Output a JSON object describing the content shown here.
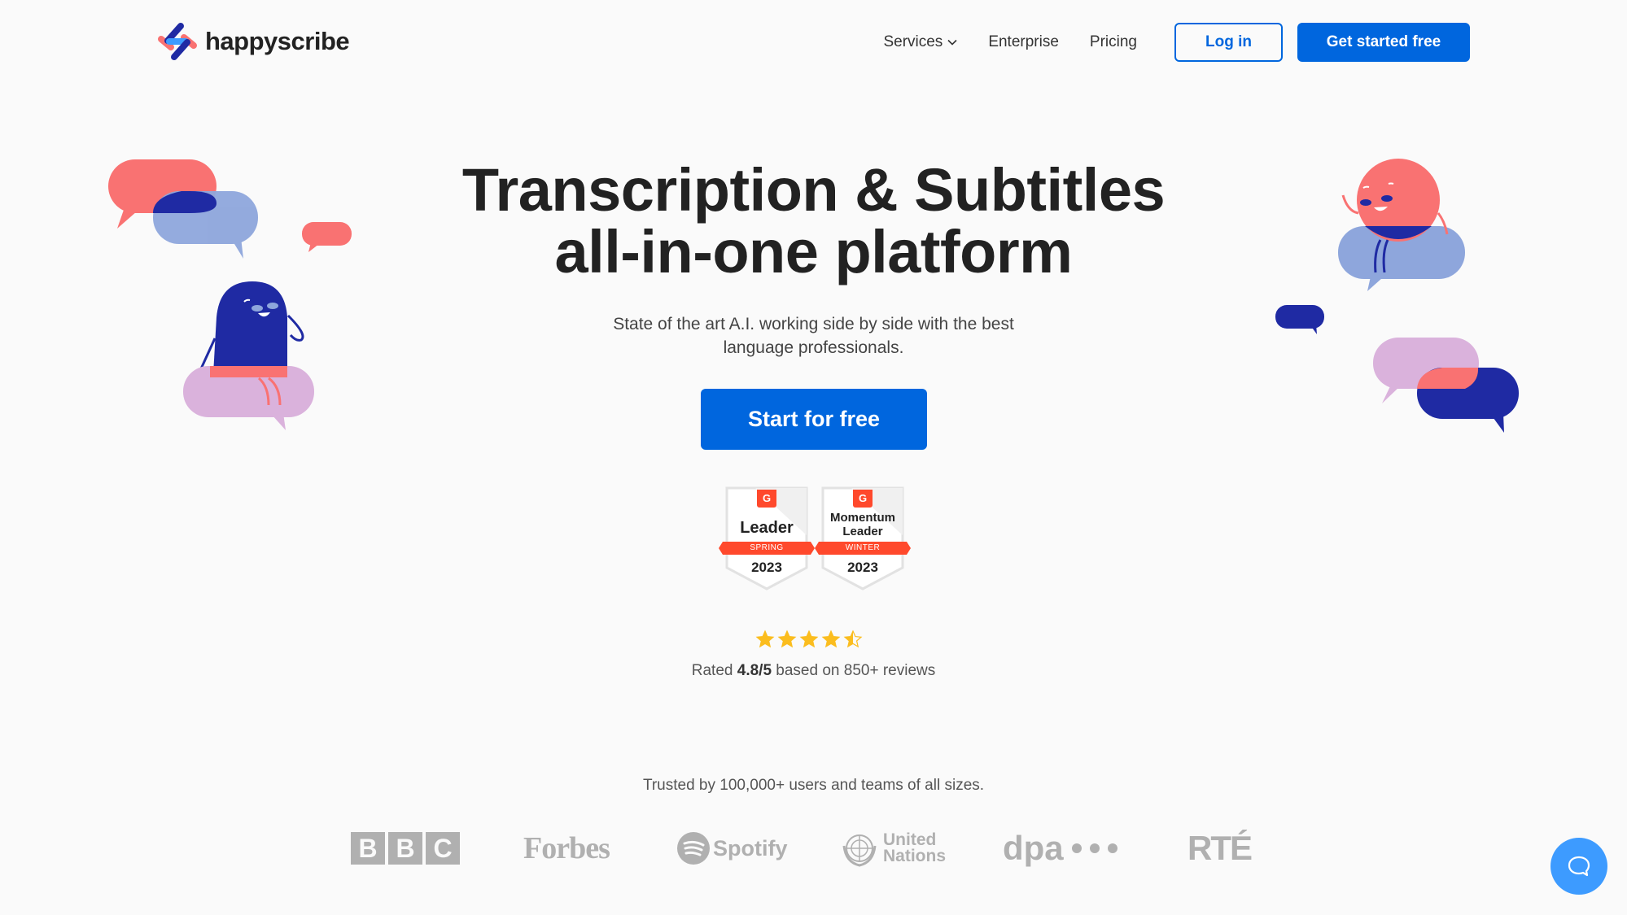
{
  "header": {
    "logo_text": "happyscribe",
    "nav": [
      {
        "label": "Services",
        "has_dropdown": true
      },
      {
        "label": "Enterprise"
      },
      {
        "label": "Pricing"
      }
    ],
    "login_label": "Log in",
    "get_started_label": "Get started free"
  },
  "hero": {
    "title_line1": "Transcription & Subtitles",
    "title_line2": "all-in-one platform",
    "subtitle_line1": "State of the art A.I. working side by side with the best",
    "subtitle_line2": "language professionals.",
    "cta_label": "Start for free"
  },
  "badges": [
    {
      "g2": "G",
      "title_lines": [
        "Leader"
      ],
      "season": "SPRING",
      "year": "2023"
    },
    {
      "g2": "G",
      "title_lines": [
        "Momentum",
        "Leader"
      ],
      "season": "WINTER",
      "year": "2023"
    }
  ],
  "rating": {
    "stars": 4.5,
    "prefix": "Rated ",
    "score": "4.8/5",
    "suffix": " based on 850+ reviews"
  },
  "trusted": {
    "text": "Trusted by 100,000+ users and teams of all sizes.",
    "logos": {
      "bbc": [
        "B",
        "B",
        "C"
      ],
      "forbes": "Forbes",
      "spotify": "Spotify",
      "un_line1": "United",
      "un_line2": "Nations",
      "dpa": "dpa",
      "rte": "RTÉ"
    }
  },
  "colors": {
    "brand_blue": "#0066de",
    "coral": "#f97272",
    "navy": "#1f2aa3",
    "periwinkle": "#8ea6dc",
    "lilac": "#dab2dc",
    "g2_red": "#ff492c",
    "star_yellow": "#fbbd1e",
    "chat_blue": "#3d9bff"
  }
}
